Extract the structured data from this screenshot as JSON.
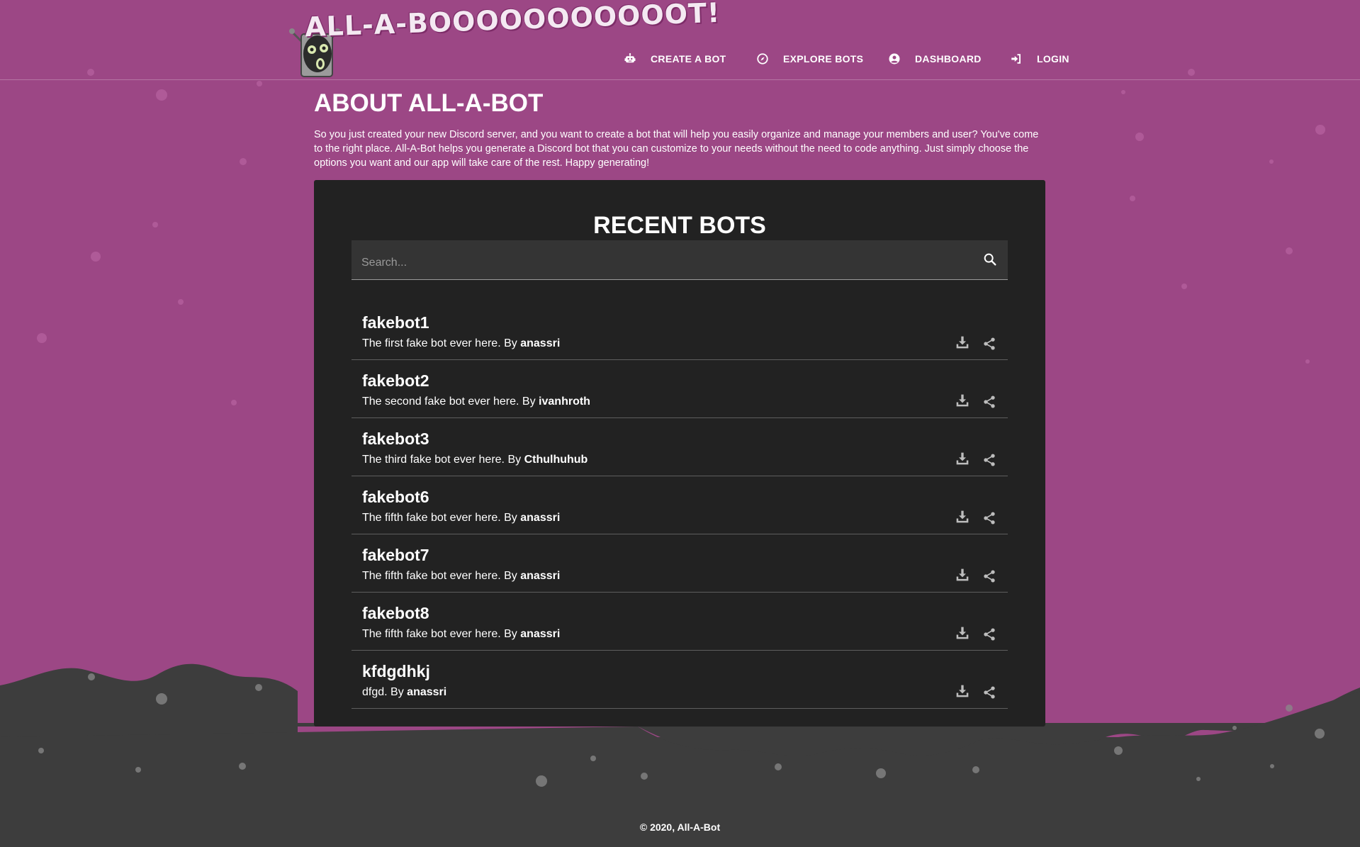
{
  "brand": {
    "logo_text": "ALL-A-BOOOOOOOOOOOT!"
  },
  "nav": [
    {
      "label": "CREATE A BOT",
      "icon": "robot-icon"
    },
    {
      "label": "EXPLORE BOTS",
      "icon": "compass-icon"
    },
    {
      "label": "DASHBOARD",
      "icon": "user-circle-icon"
    },
    {
      "label": "LOGIN",
      "icon": "sign-in-icon"
    }
  ],
  "about": {
    "title": "ABOUT ALL-A-BOT",
    "text": "So you just created your new Discord server, and you want to create a bot that will help you easily organize and manage your members and user? You've come to the right place. All-A-Bot helps you generate a Discord bot that you can customize to your needs without the need to code anything. Just simply choose the options you want and our app will take care of the rest. Happy generating!"
  },
  "recent": {
    "title": "RECENT BOTS",
    "search_placeholder": "Search...",
    "by_label": "By",
    "bots": [
      {
        "name": "fakebot1",
        "description": "The first fake bot ever here.",
        "author": "anassri"
      },
      {
        "name": "fakebot2",
        "description": "The second fake bot ever here.",
        "author": "ivanhroth"
      },
      {
        "name": "fakebot3",
        "description": "The third fake bot ever here.",
        "author": "Cthulhuhub"
      },
      {
        "name": "fakebot6",
        "description": "The fifth fake bot ever here.",
        "author": "anassri"
      },
      {
        "name": "fakebot7",
        "description": "The fifth fake bot ever here.",
        "author": "anassri"
      },
      {
        "name": "fakebot8",
        "description": "The fifth fake bot ever here.",
        "author": "anassri"
      },
      {
        "name": "kfdgdhkj",
        "description": "dfgd.",
        "author": "anassri"
      }
    ]
  },
  "footer": {
    "text": "© 2020, All-A-Bot"
  },
  "colors": {
    "background": "#9c4785",
    "panel": "#222222",
    "ground": "#3d3d3d"
  }
}
